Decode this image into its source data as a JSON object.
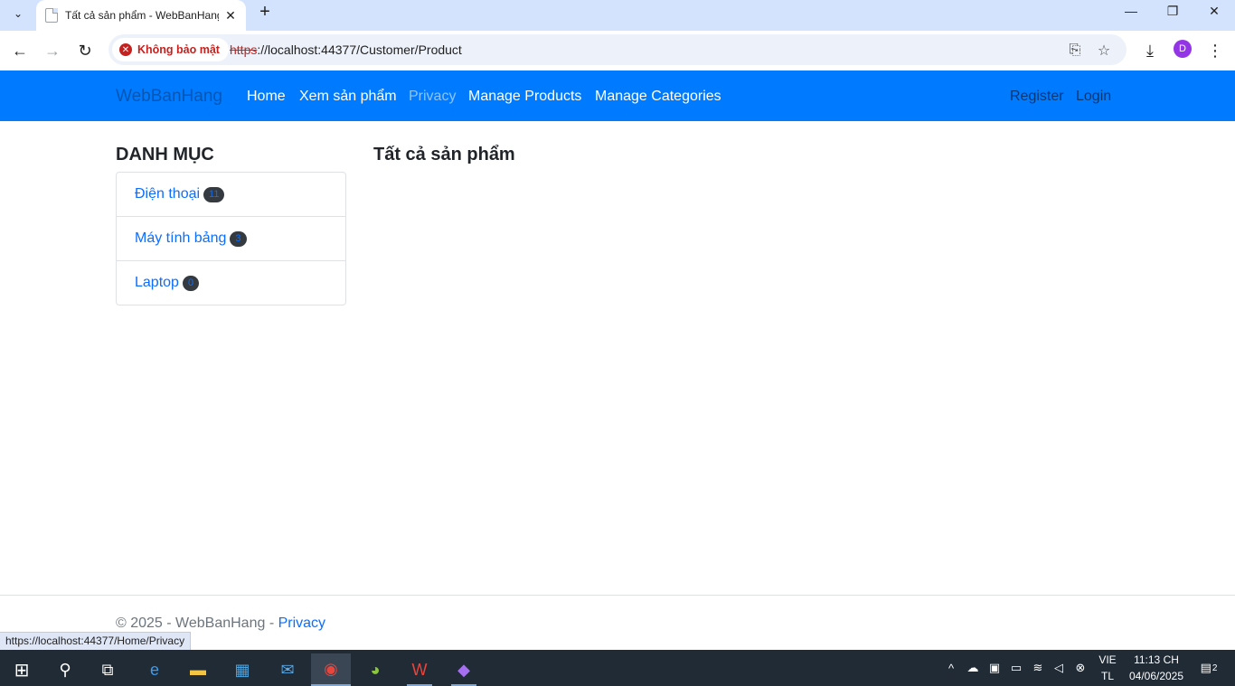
{
  "browser": {
    "tab_title": "Tất cả sản phẩm - WebBanHang",
    "security_label": "Không bảo mật",
    "url_scheme": "https",
    "url_rest": "://localhost:44377/Customer/Product",
    "profile_initial": "D",
    "status_url": "https://localhost:44377/Home/Privacy"
  },
  "navbar": {
    "brand": "WebBanHang",
    "links": [
      "Home",
      "Xem sản phẩm",
      "Privacy",
      "Manage Products",
      "Manage Categories"
    ],
    "register": "Register",
    "login": "Login"
  },
  "sidebar": {
    "title": "DANH MỤC",
    "categories": [
      {
        "name": "Điện thoại",
        "count": "11"
      },
      {
        "name": "Máy tính bảng",
        "count": "3"
      },
      {
        "name": "Laptop",
        "count": "0"
      }
    ]
  },
  "main": {
    "title": "Tất cả sản phẩm"
  },
  "footer": {
    "copyright": "© 2025 - WebBanHang - ",
    "privacy": "Privacy"
  },
  "taskbar": {
    "lang_top": "VIE",
    "lang_bottom": "TL",
    "time": "11:13 CH",
    "date": "04/06/2025",
    "notifications": "2"
  },
  "colors": {
    "navbar": "#007bff",
    "link": "#0d6efd",
    "insecure": "#c5221f"
  }
}
